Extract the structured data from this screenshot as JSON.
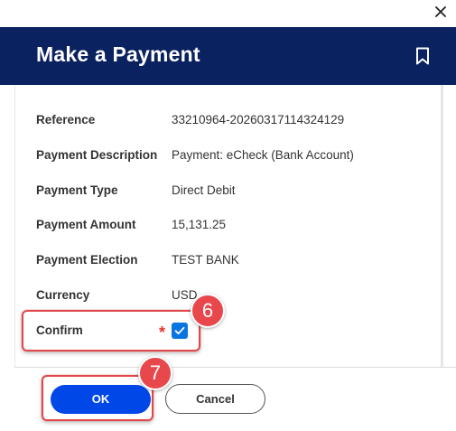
{
  "dialog": {
    "title": "Make a Payment",
    "icons": {
      "close": "close-icon",
      "bookmark": "bookmark-icon"
    }
  },
  "fields": [
    {
      "label": "Reference",
      "value": "33210964-20260317114324129"
    },
    {
      "label": "Payment Description",
      "value": "Payment: eCheck (Bank Account)"
    },
    {
      "label": "Payment Type",
      "value": "Direct Debit"
    },
    {
      "label": "Payment Amount",
      "value": "15,131.25"
    },
    {
      "label": "Payment Election",
      "value": "TEST BANK"
    },
    {
      "label": "Currency",
      "value": "USD"
    }
  ],
  "confirm": {
    "label": "Confirm",
    "required_mark": "*",
    "checked": true
  },
  "footer": {
    "ok_label": "OK",
    "cancel_label": "Cancel"
  },
  "annotations": {
    "step_confirm": "6",
    "step_ok": "7"
  },
  "colors": {
    "header_bg": "#0b2260",
    "primary_button": "#0047e8",
    "checkbox": "#0875e1",
    "annotation": "#e8474b",
    "required": "#e3352b"
  }
}
